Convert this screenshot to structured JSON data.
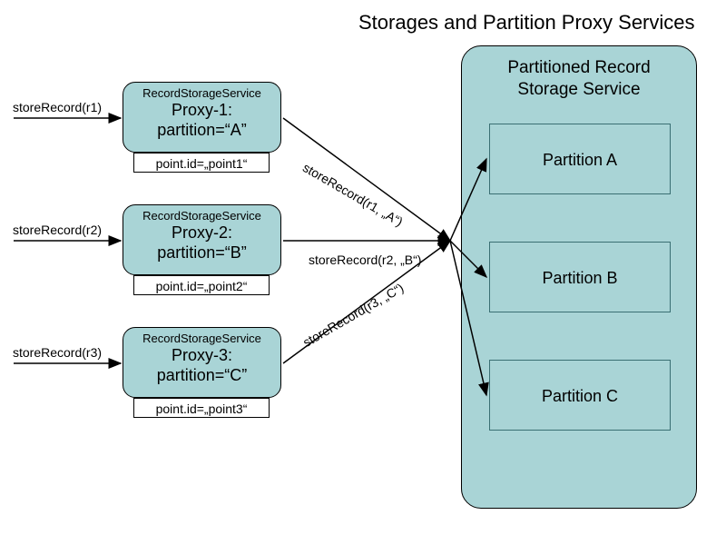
{
  "title": "Storages and Partition Proxy Services",
  "storage_service": {
    "heading_line1": "Partitioned Record",
    "heading_line2": "Storage Service",
    "partitions": {
      "a": "Partition A",
      "b": "Partition B",
      "c": "Partition C"
    }
  },
  "proxies": {
    "p1": {
      "service_label": "RecordStorageService",
      "name": "Proxy-1:",
      "partition_line": "partition=“A”",
      "point_id": "point.id=„point1“"
    },
    "p2": {
      "service_label": "RecordStorageService",
      "name": "Proxy-2:",
      "partition_line": "partition=“B”",
      "point_id": "point.id=„point2“"
    },
    "p3": {
      "service_label": "RecordStorageService",
      "name": "Proxy-3:",
      "partition_line": "partition=“C”",
      "point_id": "point.id=„point3“"
    }
  },
  "incoming_calls": {
    "c1": "storeRecord(r1)",
    "c2": "storeRecord(r2)",
    "c3": "storeRecord(r3)"
  },
  "route_calls": {
    "r1": "storeRecord(r1, „A“)",
    "r2": "storeRecord(r2, „B“)",
    "r3": "storeRecord(r3, „C“)"
  }
}
